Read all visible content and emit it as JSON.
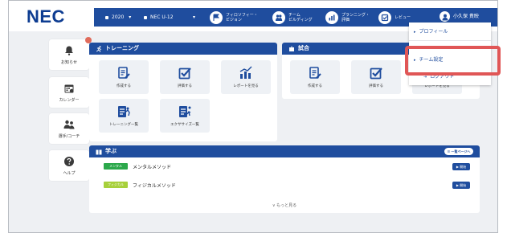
{
  "brand": {
    "logo": "NEC"
  },
  "navbar": {
    "year": "2020",
    "team": "NEC U-12",
    "items": [
      {
        "label": "フィロソフィー・\nビジョン",
        "icon": "flag-icon"
      },
      {
        "label": "チーム\nビルディング",
        "icon": "team-icon"
      },
      {
        "label": "プランニング・\n評価",
        "icon": "chart-icon"
      },
      {
        "label": "レビュー",
        "icon": "review-icon"
      }
    ],
    "user_name": "小久保 貴映"
  },
  "sidebar": {
    "items": [
      {
        "label": "お知らせ",
        "icon": "bell-icon"
      },
      {
        "label": "カレンダー",
        "icon": "calendar-icon"
      },
      {
        "label": "選手/コーチ",
        "icon": "people-icon"
      },
      {
        "label": "ヘルプ",
        "icon": "help-icon"
      }
    ]
  },
  "training": {
    "title": "トレーニング",
    "tiles": [
      "作成する",
      "評価する",
      "レポートを見る",
      "トレーニング一覧",
      "エクササイズ一覧"
    ]
  },
  "match": {
    "title": "試合",
    "tiles": [
      "作成する",
      "評価する",
      "レポートを見る"
    ]
  },
  "learn": {
    "title": "学ぶ",
    "list_button": "一覧ページへ",
    "items": [
      {
        "tag": "メンタル",
        "text": "メンタルメソッド",
        "button": "開始"
      },
      {
        "tag": "フィジカル",
        "text": "フィジカルメソッド",
        "button": "開始"
      }
    ],
    "more": "もっと見る"
  },
  "dropdown": {
    "items": [
      "プロフィール",
      "チーム設定",
      "ログアウト"
    ]
  },
  "colors": {
    "primary": "#1f4d9e",
    "mental": "#2ca84b",
    "physical": "#a7d03b",
    "highlight": "#e05656",
    "badge": "#e06b5b"
  }
}
